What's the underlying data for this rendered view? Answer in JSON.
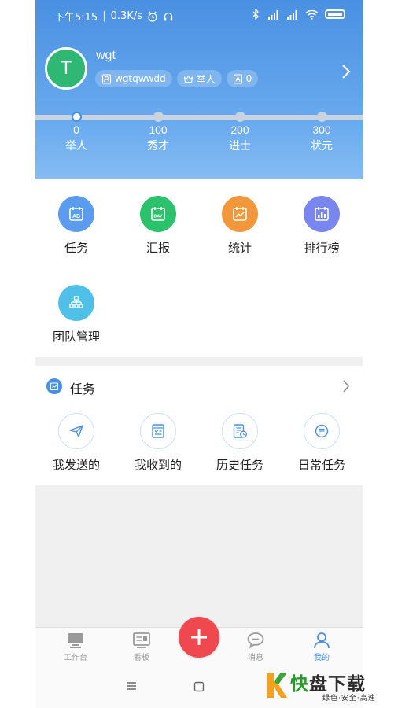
{
  "status_bar": {
    "time": "下午5:15",
    "speed": "0.3K/s"
  },
  "profile": {
    "avatar_letter": "T",
    "name": "wgt",
    "account": "wgtqwwdd",
    "rank": "举人",
    "count": "0"
  },
  "levels": [
    {
      "score": "0",
      "name": "举人",
      "reached": true
    },
    {
      "score": "100",
      "name": "秀才",
      "reached": false
    },
    {
      "score": "200",
      "name": "进士",
      "reached": false
    },
    {
      "score": "300",
      "name": "状元",
      "reached": false
    }
  ],
  "grid": [
    {
      "label": "任务",
      "icon": "task-calendar-icon",
      "color": "#5a9cf0"
    },
    {
      "label": "汇报",
      "icon": "day-report-icon",
      "color": "#2bc26b"
    },
    {
      "label": "统计",
      "icon": "statistics-icon",
      "color": "#f2973a"
    },
    {
      "label": "排行榜",
      "icon": "ranking-icon",
      "color": "#7a86f0"
    },
    {
      "label": "团队管理",
      "icon": "team-tree-icon",
      "color": "#4fc0e8"
    }
  ],
  "tasks_section": {
    "title": "任务",
    "items": [
      {
        "label": "我发送的",
        "icon": "send-plane-icon"
      },
      {
        "label": "我收到的",
        "icon": "received-inbox-icon"
      },
      {
        "label": "历史任务",
        "icon": "history-doc-icon"
      },
      {
        "label": "日常任务",
        "icon": "daily-list-icon"
      }
    ]
  },
  "bottom_nav": {
    "items": [
      {
        "label": "工作台",
        "icon": "monitor-icon",
        "active": false
      },
      {
        "label": "看板",
        "icon": "board-icon",
        "active": false
      },
      {
        "label": "消息",
        "icon": "chat-bubble-icon",
        "active": false
      },
      {
        "label": "我的",
        "icon": "person-icon",
        "active": true
      }
    ],
    "fab_icon": "plus-icon"
  },
  "watermark": {
    "brand_a": "快",
    "brand_b": "盘下载",
    "tagline": "绿色·安全·高速"
  },
  "colors": {
    "header_blue": "#4a90e2",
    "accent": "#4a90e2",
    "fab_red": "#f0484f"
  }
}
